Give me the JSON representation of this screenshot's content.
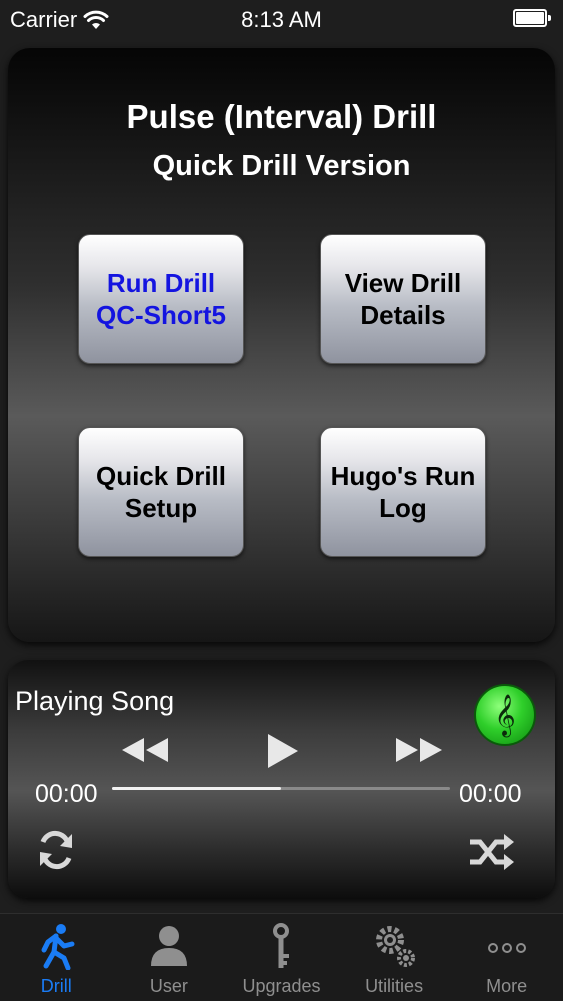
{
  "status_bar": {
    "carrier": "Carrier",
    "time": "8:13 AM"
  },
  "main": {
    "title": "Pulse (Interval) Drill",
    "subtitle": "Quick Drill Version",
    "buttons": {
      "run_drill": "Run Drill\nQC-Short5",
      "view_details": "View Drill\nDetails",
      "quick_setup": "Quick Drill\nSetup",
      "run_log": "Hugo's Run\nLog"
    },
    "colors": {
      "run_drill_text": "#1414e0"
    }
  },
  "player": {
    "song_label": "Playing Song",
    "elapsed": "00:00",
    "remaining": "00:00",
    "progress": 0.5,
    "icons": [
      "music-note-icon",
      "rewind-icon",
      "play-icon",
      "fast-forward-icon",
      "repeat-icon",
      "shuffle-icon"
    ]
  },
  "tab_bar": {
    "active_color": "#1a7cf5",
    "tabs": [
      {
        "label": "Drill",
        "icon": "runner-icon"
      },
      {
        "label": "User",
        "icon": "person-icon"
      },
      {
        "label": "Upgrades",
        "icon": "key-icon"
      },
      {
        "label": "Utilities",
        "icon": "gears-icon"
      },
      {
        "label": "More",
        "icon": "ellipsis-icon"
      }
    ]
  }
}
